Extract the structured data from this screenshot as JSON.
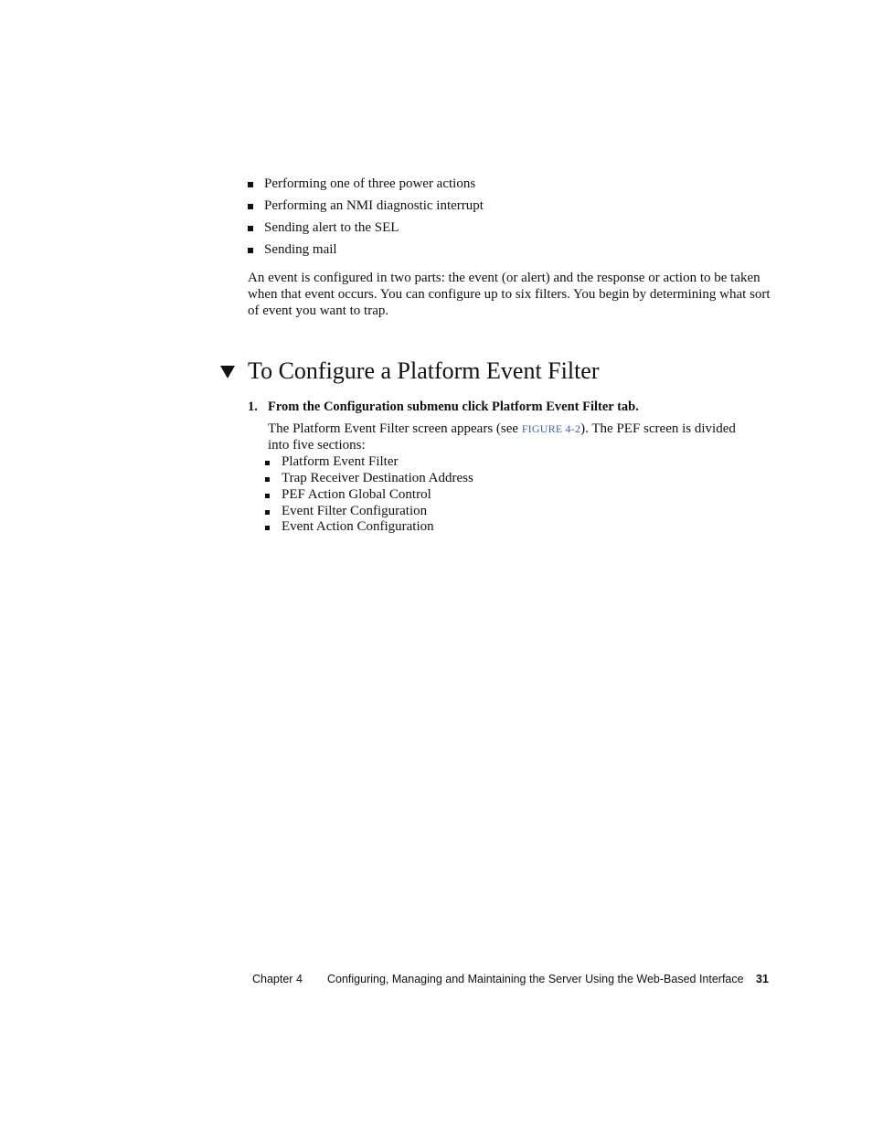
{
  "intro_list": [
    "Performing one of three power actions",
    "Performing an NMI diagnostic interrupt",
    "Sending alert to the SEL",
    "Sending mail"
  ],
  "intro_paragraph": "An event is configured in two parts: the event (or alert) and the response or action to be taken when that event occurs. You can configure up to six filters. You begin by determining what sort of event you want to trap.",
  "section": {
    "icon": "triangle-down-icon",
    "title": "To Configure a Platform Event Filter"
  },
  "step1": {
    "number": "1.",
    "text": "From the Configuration submenu click Platform Event Filter tab.",
    "body_before_link": "The Platform Event Filter screen appears (see ",
    "link_text": "FIGURE 4-2",
    "body_after_link": "). The PEF screen is divided into five sections:",
    "sections": [
      "Platform Event Filter",
      "Trap Receiver Destination Address",
      "PEF Action Global Control",
      "Event Filter Configuration",
      "Event Action Configuration"
    ]
  },
  "footer": {
    "chapter": "Chapter 4",
    "title": "Configuring, Managing and Maintaining the Server Using the Web-Based Interface",
    "page_number": "31"
  },
  "colors": {
    "link": "#3a5fa8",
    "text": "#111111"
  }
}
